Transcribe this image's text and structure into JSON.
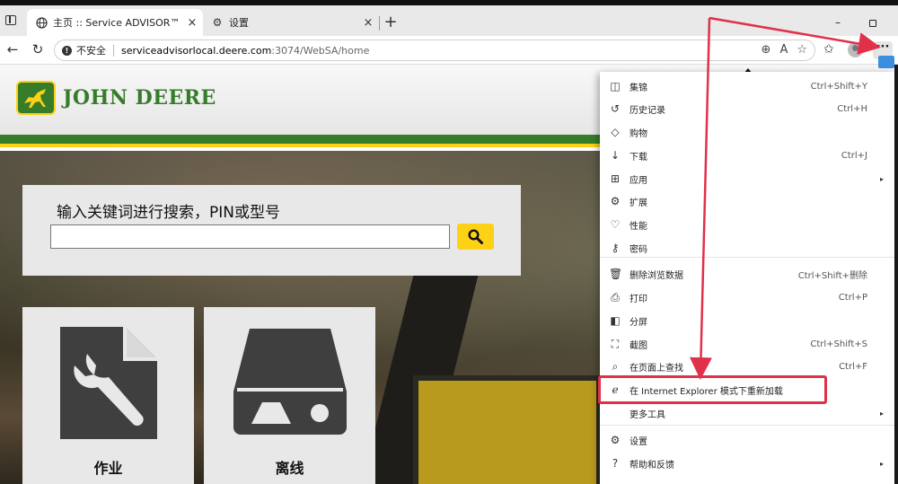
{
  "browser": {
    "tabs": [
      {
        "title": "主页 :: Service ADVISOR™",
        "close": "×"
      },
      {
        "title": "设置",
        "close": "×"
      }
    ],
    "new_tab": "+",
    "window_min": "–",
    "address": {
      "insecure_label": "不安全",
      "host": "serviceadvisorlocal.deere.com",
      "rest": ":3074/WebSA/home"
    },
    "more_label": "···"
  },
  "page": {
    "brand": "JOHN DEERE",
    "search": {
      "title": "输入关键词进行搜索，PIN或型号",
      "value": ""
    },
    "tiles": [
      {
        "label": "作业",
        "icon": "wrench-document-icon"
      },
      {
        "label": "离线",
        "icon": "hard-drive-icon"
      }
    ]
  },
  "menu": {
    "items": [
      {
        "icon": "collections-icon",
        "glyph": "◫",
        "label": "集锦",
        "shortcut": "Ctrl+Shift+Y",
        "arrow": false
      },
      {
        "icon": "history-icon",
        "glyph": "↺",
        "label": "历史记录",
        "shortcut": "Ctrl+H",
        "arrow": false
      },
      {
        "icon": "shopping-icon",
        "glyph": "◇",
        "label": "购物",
        "shortcut": "",
        "arrow": false
      },
      {
        "icon": "download-icon",
        "glyph": "↓",
        "label": "下载",
        "shortcut": "Ctrl+J",
        "arrow": false
      },
      {
        "icon": "apps-icon",
        "glyph": "⊞",
        "label": "应用",
        "shortcut": "",
        "arrow": true
      },
      {
        "icon": "extensions-icon",
        "glyph": "⚙",
        "label": "扩展",
        "shortcut": "",
        "arrow": false
      },
      {
        "icon": "performance-icon",
        "glyph": "♡",
        "label": "性能",
        "shortcut": "",
        "arrow": false
      },
      {
        "icon": "passwords-icon",
        "glyph": "⚷",
        "label": "密码",
        "shortcut": "",
        "arrow": false
      },
      {
        "icon": "delete-icon",
        "glyph": "🗑",
        "label": "删除浏览数据",
        "shortcut": "Ctrl+Shift+删除",
        "arrow": false
      },
      {
        "icon": "print-icon",
        "glyph": "⎙",
        "label": "打印",
        "shortcut": "Ctrl+P",
        "arrow": false
      },
      {
        "icon": "split-screen-icon",
        "glyph": "◧",
        "label": "分屏",
        "shortcut": "",
        "arrow": false
      },
      {
        "icon": "screenshot-icon",
        "glyph": "⛶",
        "label": "截图",
        "shortcut": "Ctrl+Shift+S",
        "arrow": false
      },
      {
        "icon": "find-icon",
        "glyph": "⌕",
        "label": "在页面上查找",
        "shortcut": "Ctrl+F",
        "arrow": false
      },
      {
        "icon": "internet-explorer-icon",
        "glyph": "ℯ",
        "label": "在 Internet Explorer 模式下重新加载",
        "shortcut": "",
        "arrow": false
      },
      {
        "icon": "",
        "glyph": "",
        "label": "更多工具",
        "shortcut": "",
        "arrow": true
      },
      {
        "icon": "settings-icon",
        "glyph": "⚙",
        "label": "设置",
        "shortcut": "",
        "arrow": false
      },
      {
        "icon": "help-icon",
        "glyph": "?",
        "label": "帮助和反馈",
        "shortcut": "",
        "arrow": true
      }
    ],
    "arrow_glyph": "▸"
  },
  "colors": {
    "jd_green": "#367c2b",
    "jd_yellow": "#fcd116",
    "annotation_red": "#e0304a"
  }
}
